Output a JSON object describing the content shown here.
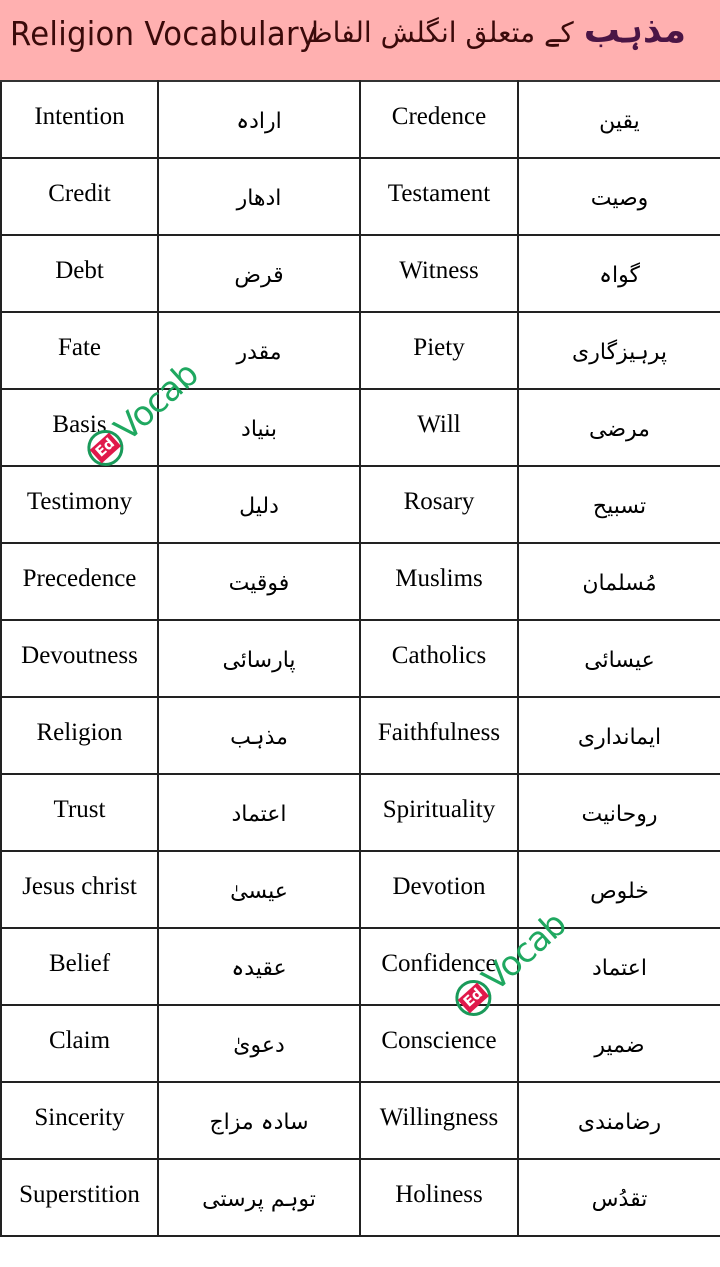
{
  "header": {
    "title_en": "Religion Vocabulary",
    "title_ur_main": "مذہب",
    "title_ur_rest": "کے متعلق انگلش الفاظ",
    "colors": {
      "background": "#ffb0b0",
      "title": "#3a0a0a",
      "accent": "#4a1545"
    }
  },
  "watermark": {
    "badge": "Ed",
    "text": "Vocab",
    "colors": {
      "green": "#1fa860",
      "red": "#e0194a"
    }
  },
  "rows": [
    {
      "en1": "Intention",
      "ur1": "ارادہ",
      "en2": "Credence",
      "ur2": "یقین"
    },
    {
      "en1": "Credit",
      "ur1": "ادھار",
      "en2": "Testament",
      "ur2": "وصیت"
    },
    {
      "en1": "Debt",
      "ur1": "قرض",
      "en2": "Witness",
      "ur2": "گواہ"
    },
    {
      "en1": "Fate",
      "ur1": "مقدر",
      "en2": "Piety",
      "ur2": "پرہیزگاری"
    },
    {
      "en1": "Basis",
      "ur1": "بنیاد",
      "en2": "Will",
      "ur2": "مرضی"
    },
    {
      "en1": "Testimony",
      "ur1": "دلیل",
      "en2": "Rosary",
      "ur2": "تسبیح"
    },
    {
      "en1": "Precedence",
      "ur1": "فوقیت",
      "en2": "Muslims",
      "ur2": "مُسلمان"
    },
    {
      "en1": "Devoutness",
      "ur1": "پارسائی",
      "en2": "Catholics",
      "ur2": "عیسائی"
    },
    {
      "en1": "Religion",
      "ur1": "مذہب",
      "en2": "Faithfulness",
      "ur2": "ایمانداری"
    },
    {
      "en1": "Trust",
      "ur1": "اعتماد",
      "en2": "Spirituality",
      "ur2": "روحانیت"
    },
    {
      "en1": "Jesus christ",
      "ur1": "عیسیٰ",
      "en2": "Devotion",
      "ur2": "خلوص"
    },
    {
      "en1": "Belief",
      "ur1": "عقیدہ",
      "en2": "Confidence",
      "ur2": "اعتماد"
    },
    {
      "en1": "Claim",
      "ur1": "دعویٰ",
      "en2": "Conscience",
      "ur2": "ضمیر"
    },
    {
      "en1": "Sincerity",
      "ur1": "سادہ مزاج",
      "en2": "Willingness",
      "ur2": "رضامندی"
    },
    {
      "en1": "Superstition",
      "ur1": "توہم پرستی",
      "en2": "Holiness",
      "ur2": "تقدُس"
    }
  ]
}
